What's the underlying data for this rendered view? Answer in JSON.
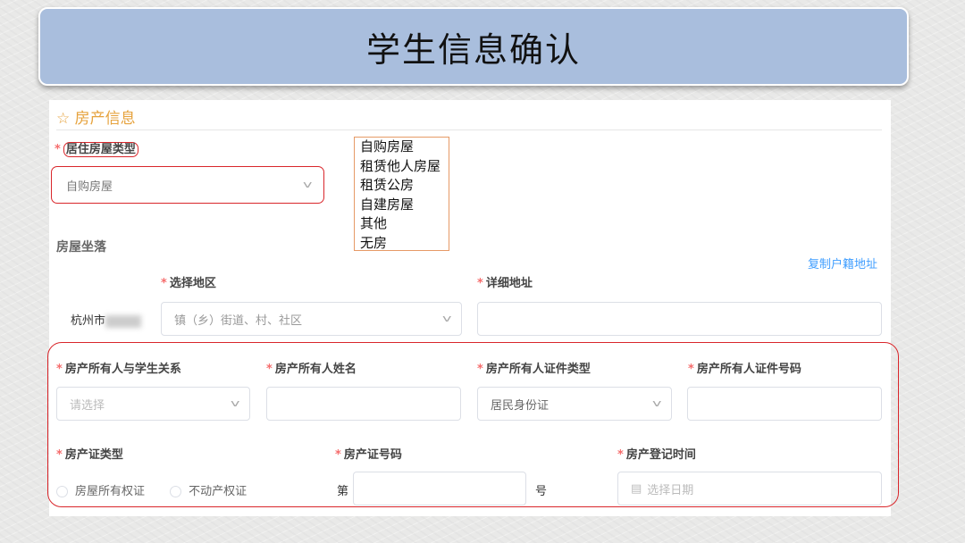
{
  "title": "学生信息确认",
  "section_title": "房产信息",
  "housing_type": {
    "label": "居住房屋类型",
    "value": "自购房屋"
  },
  "housing_options": [
    "自购房屋",
    "租赁他人房屋",
    "租赁公房",
    "自建房屋",
    "其他",
    "无房"
  ],
  "location": {
    "heading": "房屋坐落",
    "copy_link": "复制户籍地址",
    "region_label": "选择地区",
    "city": "杭州市",
    "region_placeholder": "镇（乡）街道、村、社区",
    "address_label": "详细地址"
  },
  "owner": {
    "relation_label": "房产所有人与学生关系",
    "relation_placeholder": "请选择",
    "name_label": "房产所有人姓名",
    "id_type_label": "房产所有人证件类型",
    "id_type_value": "居民身份证",
    "id_number_label": "房产所有人证件号码"
  },
  "cert": {
    "type_label": "房产证类型",
    "type_options": [
      "房屋所有权证",
      "不动产权证"
    ],
    "number_label": "房产证号码",
    "prefix": "第",
    "suffix": "号",
    "date_label": "房产登记时间",
    "date_placeholder": "选择日期"
  }
}
